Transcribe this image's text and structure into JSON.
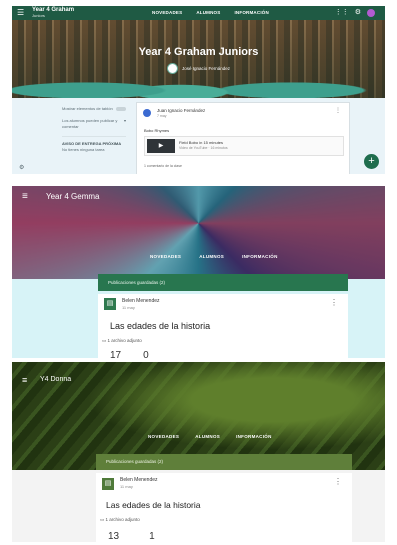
{
  "panel1": {
    "class_name": "Year 4 Graham",
    "class_sub": "Juniors",
    "nav": [
      "NOVEDADES",
      "ALUMNOS",
      "INFORMACIÓN"
    ],
    "title": "Year 4 Graham Juniors",
    "teacher": "José Ignacio Fernández",
    "side": {
      "item1": "Mostrar elementos de tablón",
      "item2": "Los alumnos pueden publicar y comentar",
      "box_title": "AVISO DE ENTREGA PRÓXIMA",
      "box_text": "No tienes ninguna tarea"
    },
    "post": {
      "author": "Juan Ignacio Fernández",
      "date": "7 may",
      "text": "Bobo Rhymes",
      "attachment_title": "Field Bobo in 15 minutes",
      "attachment_meta": "Video de YouTube · 16 minutos",
      "comment": "1 comentario de la clase"
    },
    "fab": "+",
    "icons": {
      "menu": "menu-icon",
      "grid": "apps-icon",
      "settings": "gear-icon"
    }
  },
  "panel2": {
    "class_name": "Year 4 Gemma",
    "nav": [
      "NOVEDADES",
      "ALUMNOS",
      "INFORMACIÓN"
    ],
    "saved": "Publicaciones guardadas (2)",
    "card": {
      "author": "Belen Menendez",
      "date": "11 may",
      "title": "Las edades de la historia",
      "attachments": "1 archivo adjunto",
      "count_a": "17",
      "count_b": "0"
    }
  },
  "panel3": {
    "class_name": "Y4 Donna",
    "nav": [
      "NOVEDADES",
      "ALUMNOS",
      "INFORMACIÓN"
    ],
    "saved": "Publicaciones guardadas (2)",
    "card": {
      "author": "Belen Menendez",
      "date": "11 may",
      "title": "Las edades de la historia",
      "attachments": "1 archivo adjunto",
      "count_a": "13",
      "count_b": "1"
    }
  }
}
